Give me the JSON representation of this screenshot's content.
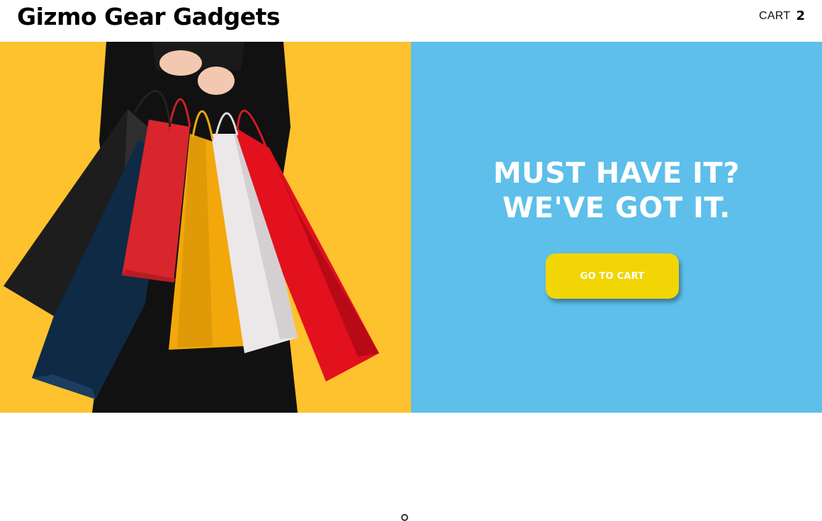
{
  "header": {
    "brand": "Gizmo Gear Gadgets",
    "cart_label": "CART",
    "cart_count": "2"
  },
  "hero": {
    "image_name": "shopping-bags-photo",
    "headline_line1": "MUST HAVE IT?",
    "headline_line2": "WE'VE GOT IT.",
    "cta_label": "GO TO CART"
  },
  "colors": {
    "image_background": "#fdc22d",
    "panel_background": "#5dbfea",
    "cta_background": "#f2d505",
    "text_light": "#ffffff",
    "text_dark": "#000000"
  }
}
